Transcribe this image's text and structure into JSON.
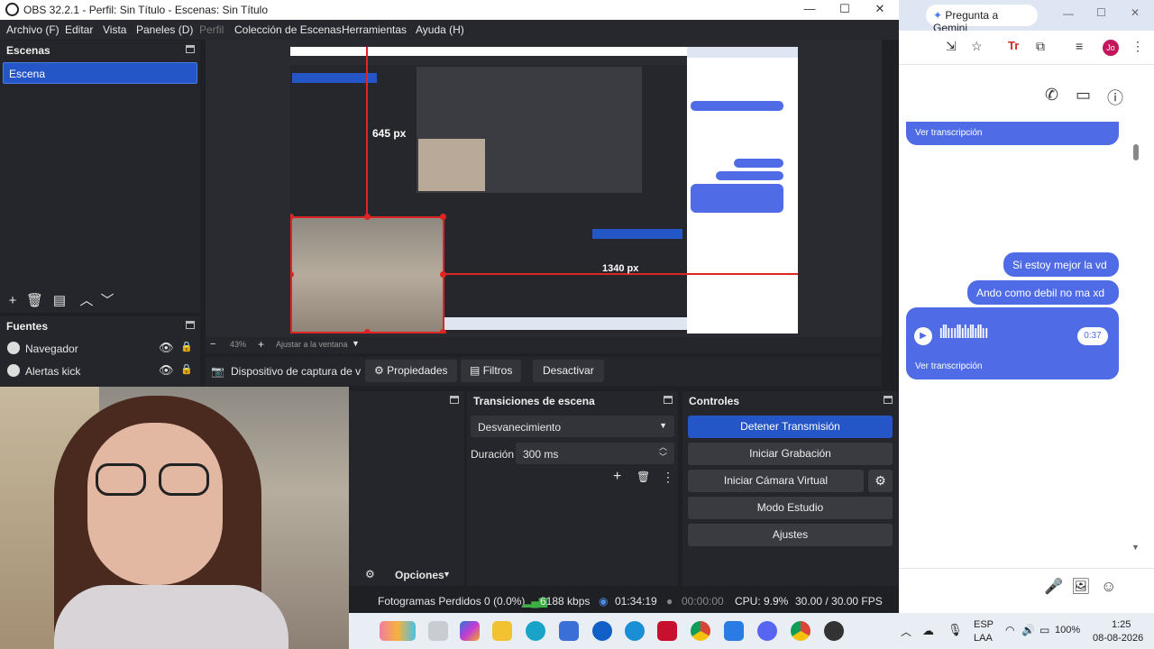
{
  "obs": {
    "window_title": "OBS 32.2.1 - Perfil: Sin Título - Escenas: Sin Título",
    "menu": [
      "Archivo (F)",
      "Editar",
      "Vista",
      "Paneles (D)",
      "Perfil",
      "Colección de Escenas",
      "Herramientas",
      "Ayuda (H)"
    ],
    "scenes": {
      "title": "Escenas",
      "items": [
        "Escena"
      ]
    },
    "sources": {
      "title": "Fuentes",
      "items": [
        "Navegador",
        "Alertas kick"
      ]
    },
    "preview": {
      "measure_left": "645 px",
      "measure_right": "1340 px",
      "zoom": "43%",
      "fit_label": "Ajustar a la ventana"
    },
    "source_toolbar": {
      "device_label": "Dispositivo de captura de v",
      "properties": "Propiedades",
      "filters": "Filtros",
      "deactivate": "Desactivar"
    },
    "transitions": {
      "title": "Transiciones de escena",
      "selected": "Desvanecimiento",
      "duration_label": "Duración",
      "duration_value": "300 ms"
    },
    "controls": {
      "title": "Controles",
      "stop_stream": "Detener Transmisión",
      "start_recording": "Iniciar Grabación",
      "start_virtual_cam": "Iniciar Cámara Virtual",
      "studio_mode": "Modo Estudio",
      "settings": "Ajustes"
    },
    "options_label": "Opciones",
    "status": {
      "dropped_frames": "Fotogramas Perdidos 0 (0.0%)",
      "bitrate": "6188 kbps",
      "stream_time": "01:34:19",
      "rec_time": "00:00:00",
      "cpu": "CPU: 9.9%",
      "fps": "30.00 / 30.00 FPS"
    }
  },
  "chrome": {
    "gemini_button": "Pregunta a Gemini",
    "profile_initials": "Jo",
    "messages": [
      {
        "text": "Ver transcripción",
        "type": "transcript-top"
      },
      {
        "text": "Si estoy mejor la vd",
        "type": "out"
      },
      {
        "text": "Ando como debil no ma xd",
        "type": "out"
      }
    ],
    "audio": {
      "duration": "0:37",
      "transcript_link": "Ver transcripción"
    }
  },
  "taskbar": {
    "lang_top": "ESP",
    "lang_bottom": "LAA",
    "battery": "100%",
    "time": "1:25",
    "date": "08-08-2026"
  }
}
